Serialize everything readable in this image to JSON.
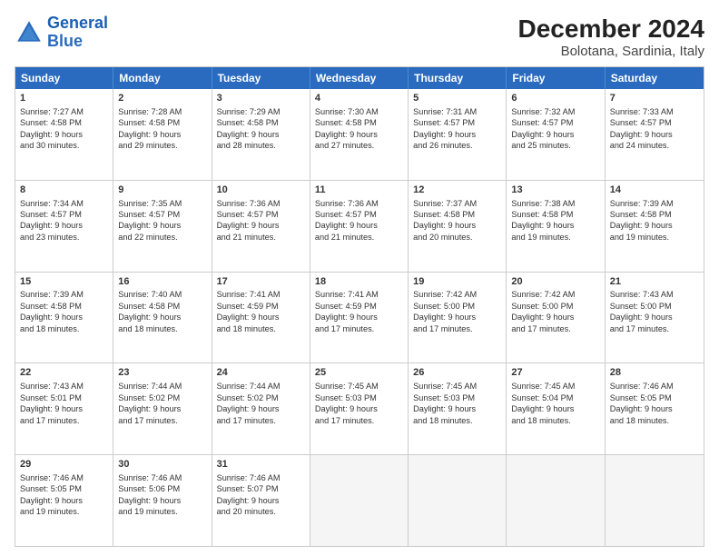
{
  "header": {
    "logo_line1": "General",
    "logo_line2": "Blue",
    "title": "December 2024",
    "subtitle": "Bolotana, Sardinia, Italy"
  },
  "weekdays": [
    "Sunday",
    "Monday",
    "Tuesday",
    "Wednesday",
    "Thursday",
    "Friday",
    "Saturday"
  ],
  "weeks": [
    [
      {
        "day": "1",
        "lines": [
          "Sunrise: 7:27 AM",
          "Sunset: 4:58 PM",
          "Daylight: 9 hours",
          "and 30 minutes."
        ]
      },
      {
        "day": "2",
        "lines": [
          "Sunrise: 7:28 AM",
          "Sunset: 4:58 PM",
          "Daylight: 9 hours",
          "and 29 minutes."
        ]
      },
      {
        "day": "3",
        "lines": [
          "Sunrise: 7:29 AM",
          "Sunset: 4:58 PM",
          "Daylight: 9 hours",
          "and 28 minutes."
        ]
      },
      {
        "day": "4",
        "lines": [
          "Sunrise: 7:30 AM",
          "Sunset: 4:58 PM",
          "Daylight: 9 hours",
          "and 27 minutes."
        ]
      },
      {
        "day": "5",
        "lines": [
          "Sunrise: 7:31 AM",
          "Sunset: 4:57 PM",
          "Daylight: 9 hours",
          "and 26 minutes."
        ]
      },
      {
        "day": "6",
        "lines": [
          "Sunrise: 7:32 AM",
          "Sunset: 4:57 PM",
          "Daylight: 9 hours",
          "and 25 minutes."
        ]
      },
      {
        "day": "7",
        "lines": [
          "Sunrise: 7:33 AM",
          "Sunset: 4:57 PM",
          "Daylight: 9 hours",
          "and 24 minutes."
        ]
      }
    ],
    [
      {
        "day": "8",
        "lines": [
          "Sunrise: 7:34 AM",
          "Sunset: 4:57 PM",
          "Daylight: 9 hours",
          "and 23 minutes."
        ]
      },
      {
        "day": "9",
        "lines": [
          "Sunrise: 7:35 AM",
          "Sunset: 4:57 PM",
          "Daylight: 9 hours",
          "and 22 minutes."
        ]
      },
      {
        "day": "10",
        "lines": [
          "Sunrise: 7:36 AM",
          "Sunset: 4:57 PM",
          "Daylight: 9 hours",
          "and 21 minutes."
        ]
      },
      {
        "day": "11",
        "lines": [
          "Sunrise: 7:36 AM",
          "Sunset: 4:57 PM",
          "Daylight: 9 hours",
          "and 21 minutes."
        ]
      },
      {
        "day": "12",
        "lines": [
          "Sunrise: 7:37 AM",
          "Sunset: 4:58 PM",
          "Daylight: 9 hours",
          "and 20 minutes."
        ]
      },
      {
        "day": "13",
        "lines": [
          "Sunrise: 7:38 AM",
          "Sunset: 4:58 PM",
          "Daylight: 9 hours",
          "and 19 minutes."
        ]
      },
      {
        "day": "14",
        "lines": [
          "Sunrise: 7:39 AM",
          "Sunset: 4:58 PM",
          "Daylight: 9 hours",
          "and 19 minutes."
        ]
      }
    ],
    [
      {
        "day": "15",
        "lines": [
          "Sunrise: 7:39 AM",
          "Sunset: 4:58 PM",
          "Daylight: 9 hours",
          "and 18 minutes."
        ]
      },
      {
        "day": "16",
        "lines": [
          "Sunrise: 7:40 AM",
          "Sunset: 4:58 PM",
          "Daylight: 9 hours",
          "and 18 minutes."
        ]
      },
      {
        "day": "17",
        "lines": [
          "Sunrise: 7:41 AM",
          "Sunset: 4:59 PM",
          "Daylight: 9 hours",
          "and 18 minutes."
        ]
      },
      {
        "day": "18",
        "lines": [
          "Sunrise: 7:41 AM",
          "Sunset: 4:59 PM",
          "Daylight: 9 hours",
          "and 17 minutes."
        ]
      },
      {
        "day": "19",
        "lines": [
          "Sunrise: 7:42 AM",
          "Sunset: 5:00 PM",
          "Daylight: 9 hours",
          "and 17 minutes."
        ]
      },
      {
        "day": "20",
        "lines": [
          "Sunrise: 7:42 AM",
          "Sunset: 5:00 PM",
          "Daylight: 9 hours",
          "and 17 minutes."
        ]
      },
      {
        "day": "21",
        "lines": [
          "Sunrise: 7:43 AM",
          "Sunset: 5:00 PM",
          "Daylight: 9 hours",
          "and 17 minutes."
        ]
      }
    ],
    [
      {
        "day": "22",
        "lines": [
          "Sunrise: 7:43 AM",
          "Sunset: 5:01 PM",
          "Daylight: 9 hours",
          "and 17 minutes."
        ]
      },
      {
        "day": "23",
        "lines": [
          "Sunrise: 7:44 AM",
          "Sunset: 5:02 PM",
          "Daylight: 9 hours",
          "and 17 minutes."
        ]
      },
      {
        "day": "24",
        "lines": [
          "Sunrise: 7:44 AM",
          "Sunset: 5:02 PM",
          "Daylight: 9 hours",
          "and 17 minutes."
        ]
      },
      {
        "day": "25",
        "lines": [
          "Sunrise: 7:45 AM",
          "Sunset: 5:03 PM",
          "Daylight: 9 hours",
          "and 17 minutes."
        ]
      },
      {
        "day": "26",
        "lines": [
          "Sunrise: 7:45 AM",
          "Sunset: 5:03 PM",
          "Daylight: 9 hours",
          "and 18 minutes."
        ]
      },
      {
        "day": "27",
        "lines": [
          "Sunrise: 7:45 AM",
          "Sunset: 5:04 PM",
          "Daylight: 9 hours",
          "and 18 minutes."
        ]
      },
      {
        "day": "28",
        "lines": [
          "Sunrise: 7:46 AM",
          "Sunset: 5:05 PM",
          "Daylight: 9 hours",
          "and 18 minutes."
        ]
      }
    ],
    [
      {
        "day": "29",
        "lines": [
          "Sunrise: 7:46 AM",
          "Sunset: 5:05 PM",
          "Daylight: 9 hours",
          "and 19 minutes."
        ]
      },
      {
        "day": "30",
        "lines": [
          "Sunrise: 7:46 AM",
          "Sunset: 5:06 PM",
          "Daylight: 9 hours",
          "and 19 minutes."
        ]
      },
      {
        "day": "31",
        "lines": [
          "Sunrise: 7:46 AM",
          "Sunset: 5:07 PM",
          "Daylight: 9 hours",
          "and 20 minutes."
        ]
      },
      {
        "day": "",
        "lines": []
      },
      {
        "day": "",
        "lines": []
      },
      {
        "day": "",
        "lines": []
      },
      {
        "day": "",
        "lines": []
      }
    ]
  ]
}
